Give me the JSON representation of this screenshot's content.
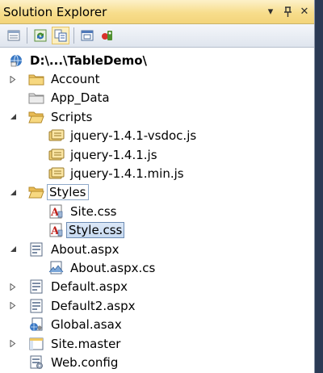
{
  "panel": {
    "title": "Solution Explorer",
    "controls": {
      "dropdown": "▾",
      "pin": "ᛘ",
      "close": "✕"
    }
  },
  "toolbar": {
    "buttons": [
      {
        "icon": "properties-icon"
      },
      {
        "icon": "refresh-icon"
      },
      {
        "icon": "show-all-files-icon",
        "active": true
      },
      {
        "icon": "view-designer-icon"
      },
      {
        "icon": "view-class-diagram-icon"
      }
    ]
  },
  "tree": {
    "root": {
      "label": "D:\\...\\TableDemo\\",
      "icon": "project-icon"
    },
    "items": [
      {
        "label": "Account",
        "icon": "folder-icon",
        "expander": "collapsed"
      },
      {
        "label": "App_Data",
        "icon": "folder-special-icon",
        "expander": "none"
      },
      {
        "label": "Scripts",
        "icon": "folder-open-icon",
        "expander": "expanded"
      },
      {
        "label": "jquery-1.4.1-vsdoc.js",
        "icon": "js-file-icon",
        "expander": "none"
      },
      {
        "label": "jquery-1.4.1.js",
        "icon": "js-file-icon",
        "expander": "none"
      },
      {
        "label": "jquery-1.4.1.min.js",
        "icon": "js-file-icon",
        "expander": "none"
      },
      {
        "label": "Styles",
        "icon": "folder-open-icon",
        "expander": "expanded"
      },
      {
        "label": "Site.css",
        "icon": "css-file-icon",
        "expander": "none"
      },
      {
        "label": "Style.css",
        "icon": "css-file-icon",
        "expander": "none"
      },
      {
        "label": "About.aspx",
        "icon": "aspx-file-icon",
        "expander": "expanded"
      },
      {
        "label": "About.aspx.cs",
        "icon": "cs-file-icon",
        "expander": "none"
      },
      {
        "label": "Default.aspx",
        "icon": "aspx-file-icon",
        "expander": "collapsed"
      },
      {
        "label": "Default2.aspx",
        "icon": "aspx-file-icon",
        "expander": "collapsed"
      },
      {
        "label": "Global.asax",
        "icon": "asax-file-icon",
        "expander": "none"
      },
      {
        "label": "Site.master",
        "icon": "master-file-icon",
        "expander": "collapsed"
      },
      {
        "label": "Web.config",
        "icon": "config-file-icon",
        "expander": "none"
      }
    ]
  }
}
